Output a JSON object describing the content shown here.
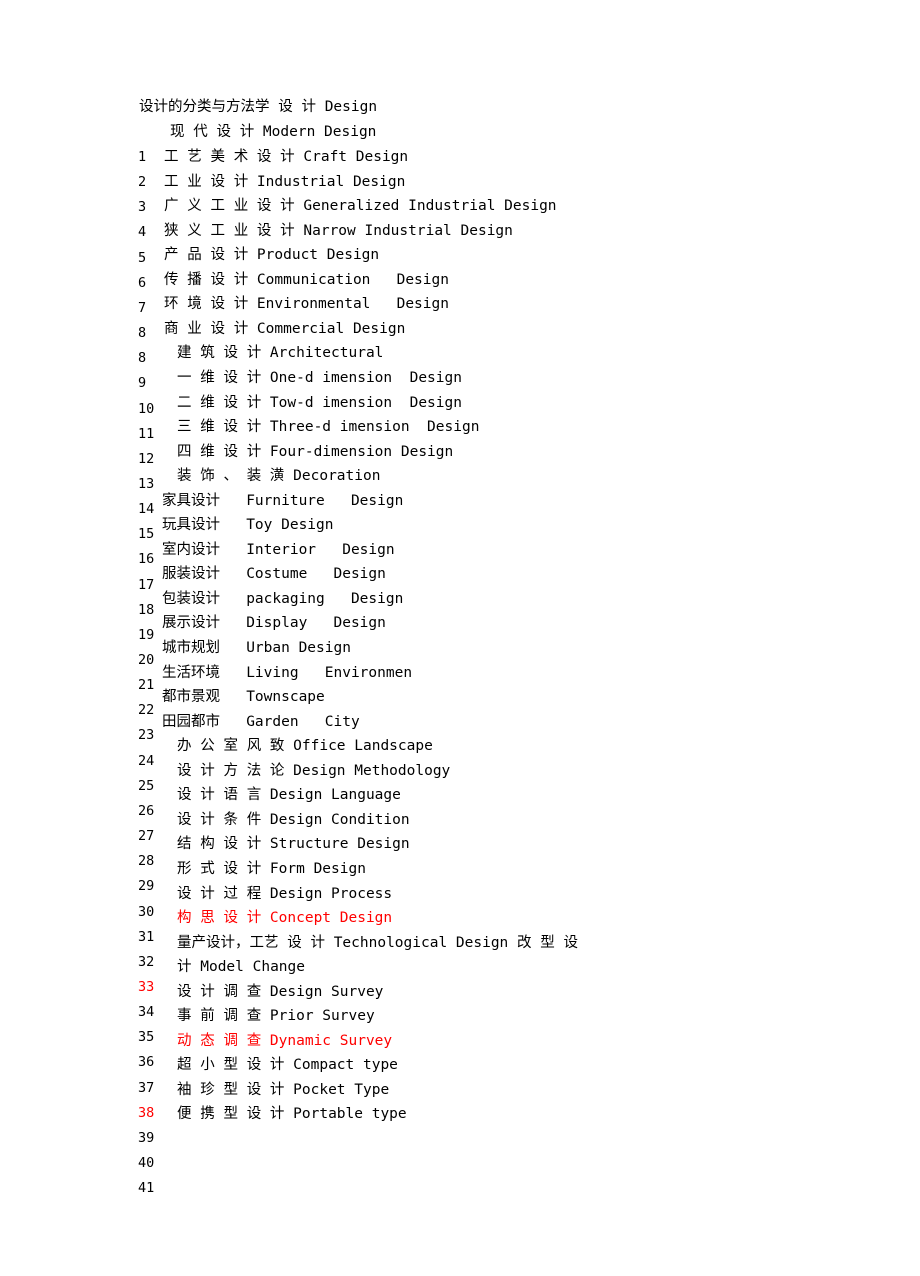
{
  "document": {
    "title_line": "设计的分类与方法学 设 计 Design",
    "subtitle_line": "现 代 设 计 Modern Design"
  },
  "colors": {
    "text": "#000000",
    "highlight": "#ff0000",
    "background": "#ffffff"
  },
  "gutter": {
    "numbers": [
      {
        "label": "1",
        "color": "black"
      },
      {
        "label": "2",
        "color": "black"
      },
      {
        "label": "3",
        "color": "black"
      },
      {
        "label": "4",
        "color": "black"
      },
      {
        "label": "5",
        "color": "black"
      },
      {
        "label": "6",
        "color": "black"
      },
      {
        "label": "7",
        "color": "black"
      },
      {
        "label": "8",
        "color": "black"
      },
      {
        "label": "8",
        "color": "black"
      },
      {
        "label": "9",
        "color": "black"
      },
      {
        "label": "10",
        "color": "black"
      },
      {
        "label": "11",
        "color": "black"
      },
      {
        "label": "12",
        "color": "black"
      },
      {
        "label": "13",
        "color": "black"
      },
      {
        "label": "14",
        "color": "black"
      },
      {
        "label": "15",
        "color": "black"
      },
      {
        "label": "16",
        "color": "black"
      },
      {
        "label": "17",
        "color": "black"
      },
      {
        "label": "18",
        "color": "black"
      },
      {
        "label": "19",
        "color": "black"
      },
      {
        "label": "20",
        "color": "black"
      },
      {
        "label": "21",
        "color": "black"
      },
      {
        "label": "22",
        "color": "black"
      },
      {
        "label": "23",
        "color": "black"
      },
      {
        "label": "24",
        "color": "black"
      },
      {
        "label": "25",
        "color": "black"
      },
      {
        "label": "26",
        "color": "black"
      },
      {
        "label": "27",
        "color": "black"
      },
      {
        "label": "28",
        "color": "black"
      },
      {
        "label": "29",
        "color": "black"
      },
      {
        "label": "30",
        "color": "black"
      },
      {
        "label": "31",
        "color": "black"
      },
      {
        "label": "32",
        "color": "black"
      },
      {
        "label": "33",
        "color": "red"
      },
      {
        "label": "34",
        "color": "black"
      },
      {
        "label": "35",
        "color": "black"
      },
      {
        "label": "36",
        "color": "black"
      },
      {
        "label": "37",
        "color": "black"
      },
      {
        "label": "38",
        "color": "red"
      },
      {
        "label": "39",
        "color": "black"
      },
      {
        "label": "40",
        "color": "black"
      },
      {
        "label": "41",
        "color": "black"
      }
    ]
  },
  "body_lines": [
    {
      "text": "工 艺 美 术 设 计 Craft Design",
      "color": "black",
      "indent": "a"
    },
    {
      "text": "工 业 设 计 Industrial Design",
      "color": "black",
      "indent": "a"
    },
    {
      "text": "广 义 工 业 设 计 Generalized Industrial Design",
      "color": "black",
      "indent": "a"
    },
    {
      "text": "狭 义 工 业 设 计 Narrow Industrial Design",
      "color": "black",
      "indent": "a"
    },
    {
      "text": "产 品 设 计 Product Design",
      "color": "black",
      "indent": "a"
    },
    {
      "text": "传 播 设 计 Communication   Design",
      "color": "black",
      "indent": "a"
    },
    {
      "text": "环 境 设 计 Environmental   Design",
      "color": "black",
      "indent": "a"
    },
    {
      "text": "商 业 设 计 Commercial Design",
      "color": "black",
      "indent": "a"
    },
    {
      "text": "建 筑 设 计 Architectural",
      "color": "black",
      "indent": "b"
    },
    {
      "text": "一 维 设 计 One-d imension  Design",
      "color": "black",
      "indent": "b"
    },
    {
      "text": "二 维 设 计 Tow-d imension  Design",
      "color": "black",
      "indent": "b"
    },
    {
      "text": "三 维 设 计 Three-d imension  Design",
      "color": "black",
      "indent": "b"
    },
    {
      "text": "四 维 设 计 Four-dimension Design",
      "color": "black",
      "indent": "b"
    },
    {
      "text": "装 饰 、 装 潢 Decoration",
      "color": "black",
      "indent": "b"
    },
    {
      "text": "家具设计   Furniture   Design",
      "color": "black",
      "indent": "c"
    },
    {
      "text": "玩具设计   Toy Design",
      "color": "black",
      "indent": "c"
    },
    {
      "text": "室内设计   Interior   Design",
      "color": "black",
      "indent": "c"
    },
    {
      "text": "服装设计   Costume   Design",
      "color": "black",
      "indent": "c"
    },
    {
      "text": "包装设计   packaging   Design",
      "color": "black",
      "indent": "c"
    },
    {
      "text": "展示设计   Display   Design",
      "color": "black",
      "indent": "c"
    },
    {
      "text": "城市规划   Urban Design",
      "color": "black",
      "indent": "c"
    },
    {
      "text": "生活环境   Living   Environmen",
      "color": "black",
      "indent": "c"
    },
    {
      "text": "都市景观   Townscape",
      "color": "black",
      "indent": "c"
    },
    {
      "text": "田园都市   Garden   City",
      "color": "black",
      "indent": "c"
    },
    {
      "text": "办 公 室 风 致 Office Landscape",
      "color": "black",
      "indent": "d"
    },
    {
      "text": "设 计 方 法 论 Design Methodology",
      "color": "black",
      "indent": "d"
    },
    {
      "text": "设 计 语 言 Design Language",
      "color": "black",
      "indent": "d"
    },
    {
      "text": "设 计 条 件 Design Condition",
      "color": "black",
      "indent": "d"
    },
    {
      "text": "结 构 设 计 Structure Design",
      "color": "black",
      "indent": "d"
    },
    {
      "text": "形 式 设 计 Form Design",
      "color": "black",
      "indent": "d"
    },
    {
      "text": "设 计 过 程 Design Process",
      "color": "black",
      "indent": "d"
    },
    {
      "text": "构 思 设 计 Concept Design",
      "color": "red",
      "indent": "d"
    },
    {
      "text": "量产设计，工艺 设 计 Technological Design 改 型 设",
      "color": "black",
      "indent": "d"
    },
    {
      "text": "计 Model Change",
      "color": "black",
      "indent": "d"
    },
    {
      "text": "设 计 调 查 Design Survey",
      "color": "black",
      "indent": "d"
    },
    {
      "text": "事 前 调 查 Prior Survey",
      "color": "black",
      "indent": "d"
    },
    {
      "text": "动 态 调 查 Dynamic Survey",
      "color": "red",
      "indent": "d"
    },
    {
      "text": "超 小 型 设 计 Compact type",
      "color": "black",
      "indent": "d"
    },
    {
      "text": "袖 珍 型 设 计 Pocket Type",
      "color": "black",
      "indent": "d"
    },
    {
      "text": "便 携 型 设 计 Portable type",
      "color": "black",
      "indent": "d"
    }
  ]
}
